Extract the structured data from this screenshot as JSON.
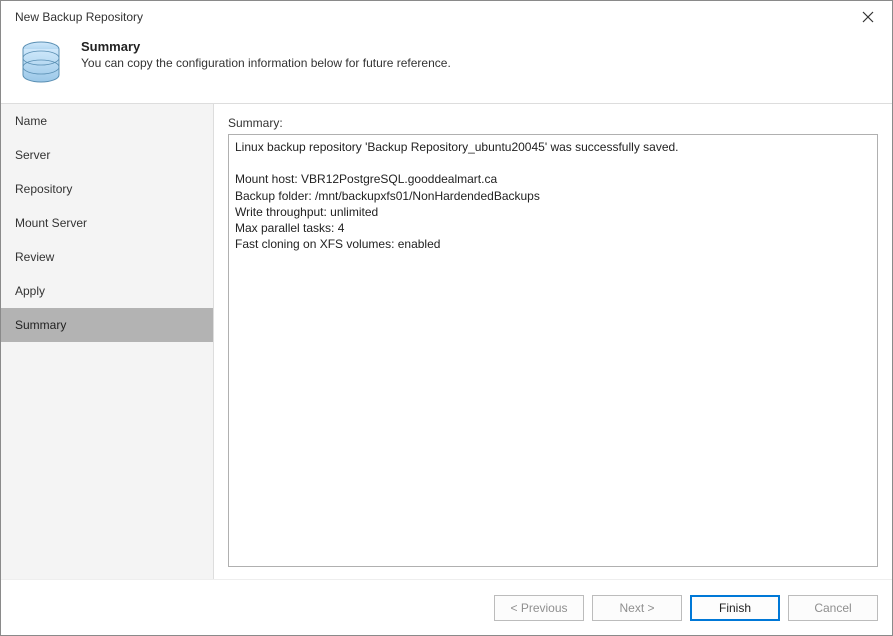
{
  "window": {
    "title": "New Backup Repository"
  },
  "header": {
    "title": "Summary",
    "subtitle": "You can copy the configuration information below for future reference."
  },
  "sidebar": {
    "items": [
      {
        "label": "Name"
      },
      {
        "label": "Server"
      },
      {
        "label": "Repository"
      },
      {
        "label": "Mount Server"
      },
      {
        "label": "Review"
      },
      {
        "label": "Apply"
      },
      {
        "label": "Summary"
      }
    ],
    "active_index": 6
  },
  "main": {
    "summary_label": "Summary:",
    "summary_text": "Linux backup repository 'Backup Repository_ubuntu20045' was successfully saved.\n\nMount host: VBR12PostgreSQL.gooddealmart.ca\nBackup folder: /mnt/backupxfs01/NonHardendedBackups\nWrite throughput: unlimited\nMax parallel tasks: 4\nFast cloning on XFS volumes: enabled"
  },
  "footer": {
    "previous": "< Previous",
    "next": "Next >",
    "finish": "Finish",
    "cancel": "Cancel"
  }
}
